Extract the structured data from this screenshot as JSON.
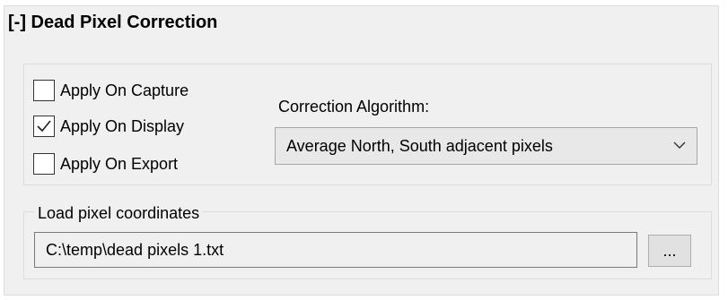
{
  "section": {
    "title": "[-] Dead Pixel Correction"
  },
  "options": [
    {
      "label": "Apply On Capture",
      "checked": false
    },
    {
      "label": "Apply On Display",
      "checked": true
    },
    {
      "label": "Apply On Export",
      "checked": false
    }
  ],
  "algorithm": {
    "label": "Correction Algorithm:",
    "selected": "Average North, South adjacent pixels",
    "icon": "chevron-down-icon"
  },
  "load": {
    "group_label": "Load pixel coordinates",
    "path_value": "C:\\temp\\dead pixels 1.txt",
    "browse_label": "...",
    "browse_icon": "ellipsis-icon"
  },
  "colors": {
    "panel_bg": "#f0f0f0",
    "border": "#dcdcdc",
    "dropdown_bg": "#e8e8e8",
    "button_bg": "#e1e1e1"
  }
}
